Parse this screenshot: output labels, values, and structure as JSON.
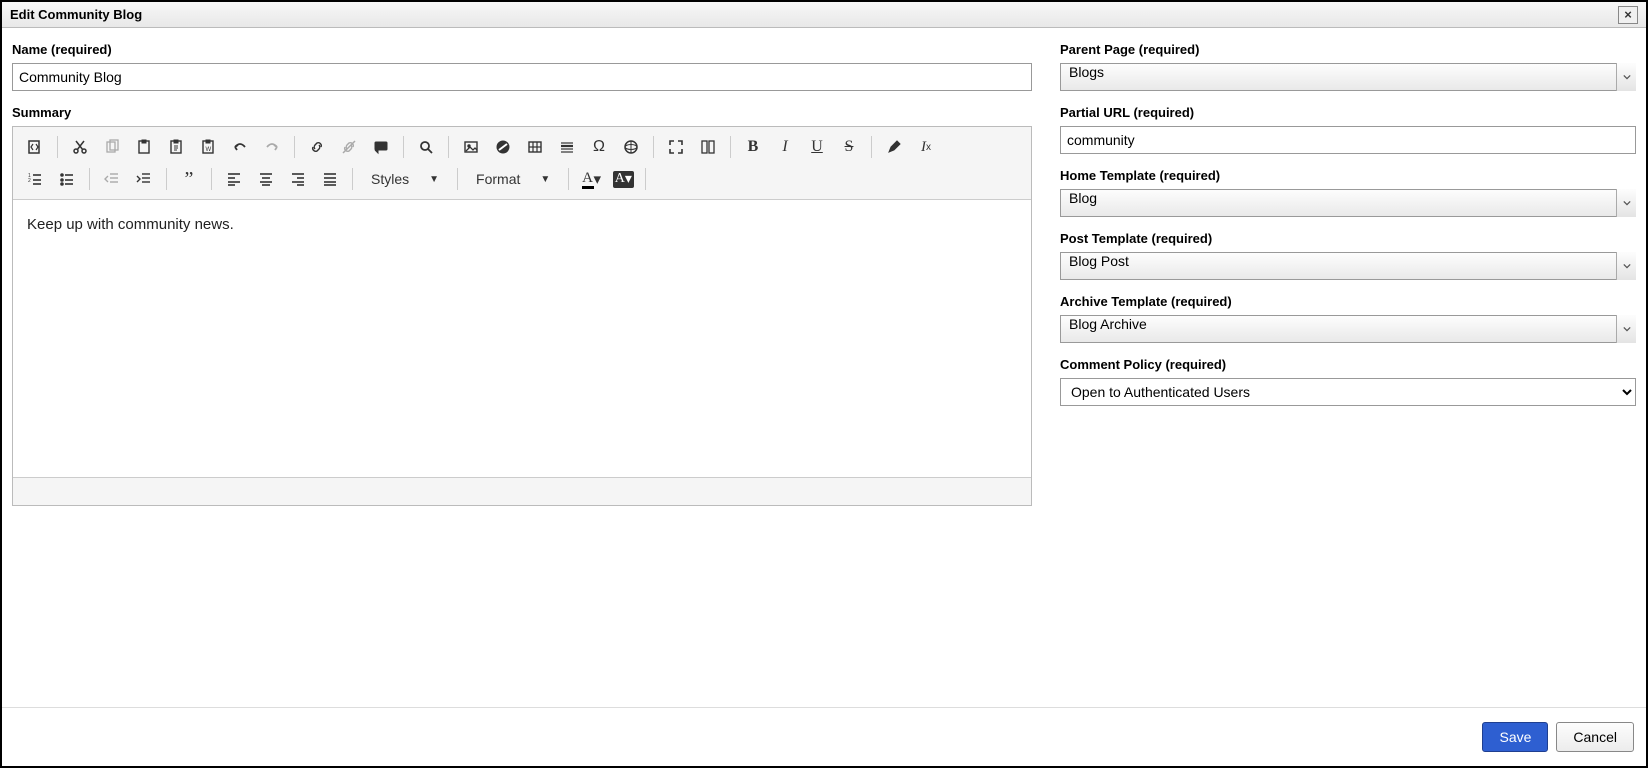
{
  "dialog": {
    "title": "Edit Community Blog",
    "close_icon": "×"
  },
  "left": {
    "name_label": "Name (required)",
    "name_value": "Community Blog",
    "summary_label": "Summary",
    "summary_content": "Keep up with community news."
  },
  "toolbar": {
    "styles_label": "Styles",
    "format_label": "Format"
  },
  "right": {
    "parent_page_label": "Parent Page (required)",
    "parent_page_value": "Blogs",
    "partial_url_label": "Partial URL (required)",
    "partial_url_value": "community",
    "home_template_label": "Home Template (required)",
    "home_template_value": "Blog",
    "post_template_label": "Post Template (required)",
    "post_template_value": "Blog Post",
    "archive_template_label": "Archive Template (required)",
    "archive_template_value": "Blog Archive",
    "comment_policy_label": "Comment Policy (required)",
    "comment_policy_value": "Open to Authenticated Users"
  },
  "footer": {
    "save_label": "Save",
    "cancel_label": "Cancel"
  }
}
